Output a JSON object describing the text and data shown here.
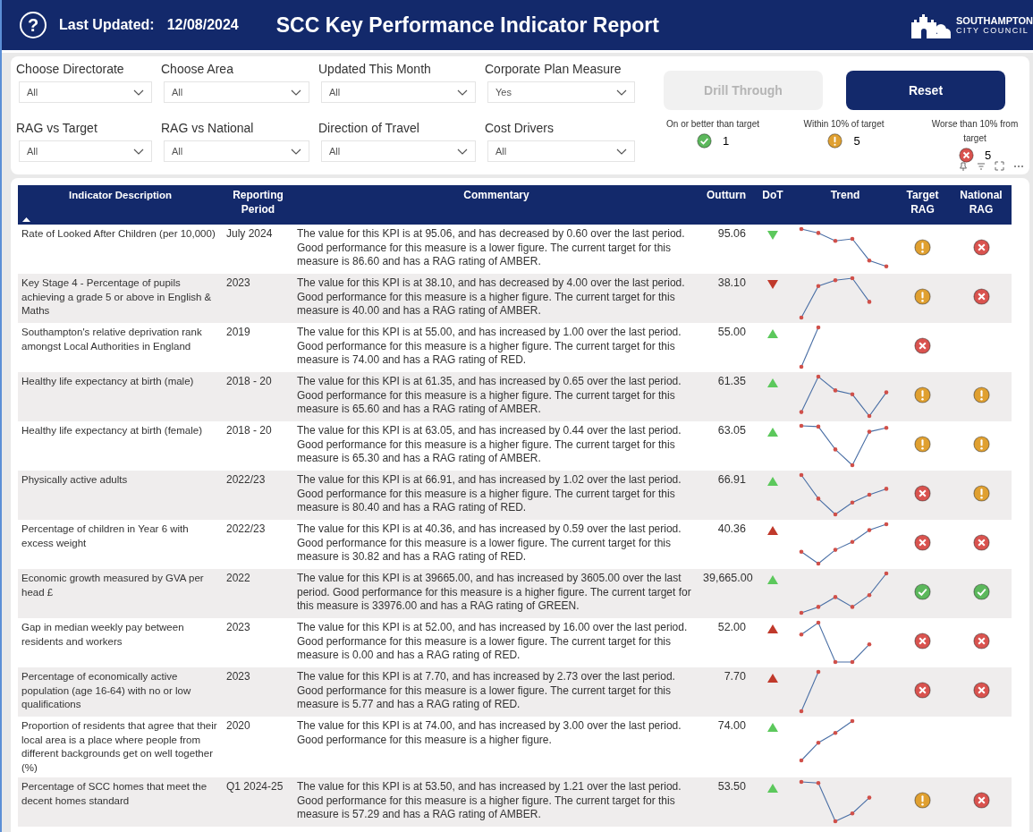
{
  "header": {
    "help_icon": "?",
    "last_updated_label": "Last Updated:",
    "last_updated_value": "12/08/2024",
    "title": "SCC Key Performance Indicator Report",
    "logo_line1": "SOUTHAMPTON",
    "logo_line2": "CITY COUNCIL"
  },
  "filters": [
    {
      "label": "Choose Directorate",
      "value": "All"
    },
    {
      "label": "Choose Area",
      "value": "All"
    },
    {
      "label": "Updated This Month",
      "value": "All"
    },
    {
      "label": "Corporate Plan Measure",
      "value": "Yes"
    },
    {
      "label": "RAG vs Target",
      "value": "All"
    },
    {
      "label": "RAG vs National",
      "value": "All"
    },
    {
      "label": "Direction of Travel",
      "value": "All"
    },
    {
      "label": "Cost Drivers",
      "value": "All"
    }
  ],
  "buttons": [
    {
      "label": "Drill Through",
      "disabled": true
    },
    {
      "label": "Reset",
      "disabled": false
    }
  ],
  "summary": [
    {
      "label": "On or better than target",
      "kind": "check",
      "color": "#5cb85c",
      "count": "1"
    },
    {
      "label": "Within 10% of target",
      "kind": "warning",
      "color": "#e0a030",
      "count": "5"
    },
    {
      "label": "Worse than 10% from target",
      "kind": "cross",
      "color": "#d9534f",
      "count": "5"
    }
  ],
  "table": {
    "columns": [
      "Indicator Description",
      "Reporting Period",
      "Commentary",
      "Outturn",
      "DoT",
      "Trend",
      "Target RAG",
      "National RAG"
    ],
    "rows": [
      {
        "description": "Rate of Looked After Children (per 10,000)",
        "period": "July 2024",
        "commentary": "The value for this KPI is at 95.06, and has decreased by 0.60 over the last period. Good performance for this measure is a lower figure. The current target for this measure is 86.60 and has a RAG rating of AMBER.",
        "outturn": "95.06",
        "rising": false,
        "color": "#5cc85c",
        "target_rag": {
          "kind": "warning"
        },
        "national_rag": {
          "kind": "cross"
        }
      },
      {
        "description": "Key Stage 4 - Percentage of pupils achieving a grade 5 or above in English & Maths",
        "period": "2023",
        "commentary": "The value for this KPI is at 38.10, and has decreased by 4.00 over the last period. Good performance for this measure is a higher figure. The current target for this measure is 40.00 and has a RAG rating of AMBER.",
        "outturn": "38.10",
        "rising": false,
        "color": "#c0392b",
        "target_rag": {
          "kind": "warning"
        },
        "national_rag": {
          "kind": "cross"
        }
      },
      {
        "description": "Southampton's relative deprivation rank amongst Local Authorities in England",
        "period": "2019",
        "commentary": "The value for this KPI is at 55.00, and has increased by 1.00 over the last period. Good performance for this measure is a higher figure. The current target for this measure is 74.00 and has a RAG rating of RED.",
        "outturn": "55.00",
        "rising": true,
        "color": "#5cc85c",
        "target_rag": {
          "kind": "cross"
        }
      },
      {
        "description": "Healthy life expectancy at birth (male)",
        "period": "2018 - 20",
        "commentary": "The value for this KPI is at 61.35, and has increased by 0.65 over the last period. Good performance for this measure is a higher figure. The current target for this measure is 65.60 and has a RAG rating of AMBER.",
        "outturn": "61.35",
        "rising": true,
        "color": "#5cc85c",
        "target_rag": {
          "kind": "warning"
        },
        "national_rag": {
          "kind": "warning"
        }
      },
      {
        "description": "Healthy life expectancy at birth (female)",
        "period": "2018 - 20",
        "commentary": "The value for this KPI is at 63.05, and has increased by 0.44 over the last period. Good performance for this measure is a higher figure. The current target for this measure is 65.30 and has a RAG rating of AMBER.",
        "outturn": "63.05",
        "rising": true,
        "color": "#5cc85c",
        "target_rag": {
          "kind": "warning"
        },
        "national_rag": {
          "kind": "warning"
        }
      },
      {
        "description": "Physically active adults",
        "period": "2022/23",
        "commentary": "The value for this KPI is at 66.91, and has increased by 1.02 over the last period. Good performance for this measure is a higher figure. The current target for this measure is 80.40 and has a RAG rating of RED.",
        "outturn": "66.91",
        "rising": true,
        "color": "#5cc85c",
        "target_rag": {
          "kind": "cross"
        },
        "national_rag": {
          "kind": "warning"
        }
      },
      {
        "description": "Percentage of children in Year 6 with excess weight",
        "period": "2022/23",
        "commentary": "The value for this KPI is at 40.36, and has increased by 0.59 over the last period. Good performance for this measure is a lower figure. The current target for this measure is 30.82 and has a RAG rating of RED.",
        "outturn": "40.36",
        "rising": true,
        "color": "#c0392b",
        "target_rag": {
          "kind": "cross"
        },
        "national_rag": {
          "kind": "cross"
        }
      },
      {
        "description": "Economic growth measured by GVA per head £",
        "period": "2022",
        "commentary": "The value for this KPI is at 39665.00, and has increased by 3605.00 over the last period. Good performance for this measure is a higher figure. The current target for this measure is 33976.00 and has a RAG rating of GREEN.",
        "outturn": "39,665.00",
        "rising": true,
        "color": "#5cc85c",
        "target_rag": {
          "kind": "check"
        },
        "national_rag": {
          "kind": "check"
        }
      },
      {
        "description": "Gap in median weekly pay between residents and workers",
        "period": "2023",
        "commentary": "The value for this KPI is at 52.00, and has increased by 16.00 over the last period. Good performance for this measure is a lower figure. The current target for this measure is 0.00 and has a RAG rating of RED.",
        "outturn": "52.00",
        "rising": true,
        "color": "#c0392b",
        "target_rag": {
          "kind": "cross"
        },
        "national_rag": {
          "kind": "cross"
        }
      },
      {
        "description": "Percentage of economically active population (age 16-64) with no or low qualifications",
        "period": "2023",
        "commentary": "The value for this KPI is at 7.70, and has increased by 2.73 over the last period. Good performance for this measure is a lower figure. The current target for this measure is 5.77 and has a RAG rating of RED.",
        "outturn": "7.70",
        "rising": true,
        "color": "#c0392b",
        "target_rag": {
          "kind": "cross"
        },
        "national_rag": {
          "kind": "cross"
        }
      },
      {
        "description": "Proportion of residents that agree that their local area is a place where people from different backgrounds get on well together (%)",
        "period": "2020",
        "commentary": "The value for this KPI is at 74.00, and has increased by 3.00 over the last period. Good performance for this measure is a higher figure.",
        "outturn": "74.00",
        "rising": true,
        "color": "#5cc85c"
      },
      {
        "description": "Percentage of SCC homes that meet the decent homes standard",
        "period": "Q1 2024-25",
        "commentary": "The value for this KPI is at 53.50, and has increased by 1.21 over the last period. Good performance for this measure is a higher figure. The current target for this measure is 57.29 and has a RAG rating of AMBER.",
        "outturn": "53.50",
        "rising": true,
        "color": "#5cc85c",
        "target_rag": {
          "kind": "warning"
        },
        "national_rag": {
          "kind": "cross"
        }
      }
    ]
  }
}
